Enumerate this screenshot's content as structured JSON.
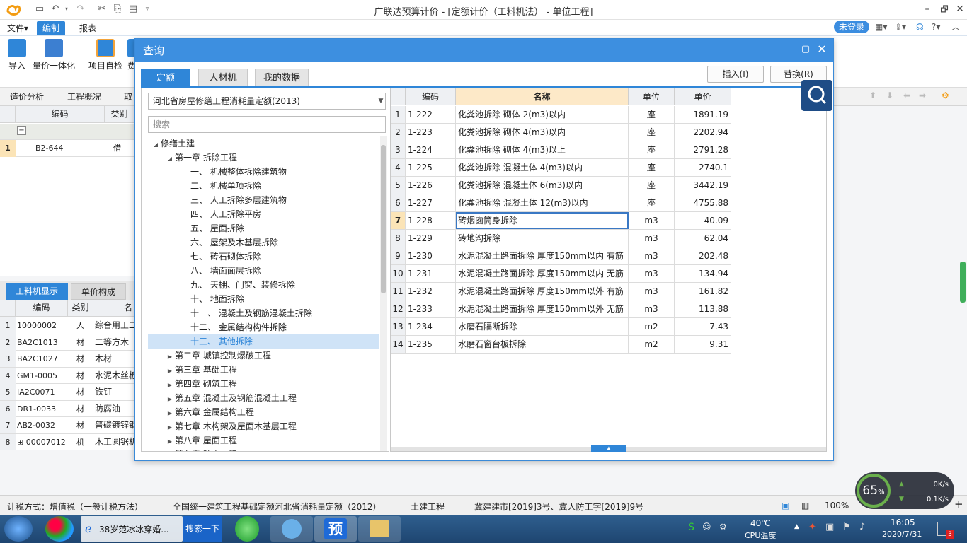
{
  "app": {
    "title": "广联达预算计价 - [定额计价（工料机法） - 单位工程]",
    "window_min": "–",
    "window_restore": "🗗",
    "window_close": "✕"
  },
  "menu": {
    "file": "文件▾",
    "edit": "编制",
    "report": "报表",
    "login": "未登录"
  },
  "ribbon": {
    "import": "导入",
    "price_integration": "量价一体化",
    "self_check": "项目自检",
    "more": "费"
  },
  "left_tabs": [
    "造价分析",
    "工程概况",
    "取"
  ],
  "upper_grid": {
    "headers": [
      "编码",
      "类别"
    ],
    "rows": [
      {
        "num": "",
        "code": "⊟",
        "type": ""
      },
      {
        "num": "1",
        "code": "B2-644",
        "type": "借"
      }
    ]
  },
  "lower_tabs": {
    "active": "工料机显示",
    "second": "单价构成"
  },
  "lower_grid": {
    "headers": [
      "编码",
      "类别",
      "名"
    ],
    "rows": [
      {
        "num": "1",
        "code": "10000002",
        "type": "人",
        "name": "综合用工二"
      },
      {
        "num": "2",
        "code": "BA2C1013",
        "type": "材",
        "name": "二等方木"
      },
      {
        "num": "3",
        "code": "BA2C1027",
        "type": "材",
        "name": "木材"
      },
      {
        "num": "4",
        "code": "GM1-0005",
        "type": "材",
        "name": "水泥木丝板"
      },
      {
        "num": "5",
        "code": "IA2C0071",
        "type": "材",
        "name": "铁钉"
      },
      {
        "num": "6",
        "code": "DR1-0033",
        "type": "材",
        "name": "防腐油"
      },
      {
        "num": "7",
        "code": "AB2-0032",
        "type": "材",
        "name": "普碳镀锌钢"
      },
      {
        "num": "8",
        "code": "⊞ 00007012",
        "type": "机",
        "name": "木工圆锯机"
      }
    ]
  },
  "status": {
    "tax": "计税方式：增值税（一般计税方法）",
    "quota": "全国统一建筑工程基础定额河北省消耗量定额（2012）",
    "discipline": "土建工程",
    "doc": "冀建建市[2019]3号、冀人防工字[2019]9号",
    "zoom": "100%"
  },
  "taskbar": {
    "browser_title": "38岁范冰冰穿婚...",
    "search_btn": "搜索一下",
    "pre": "预",
    "temp": "40℃",
    "temp_label": "CPU温度",
    "time": "16:05",
    "date": "2020/7/31",
    "notif": "3"
  },
  "monitor": {
    "cpu": "65",
    "up": "0K/s",
    "down": "0.1K/s"
  },
  "dialog": {
    "title": "查询",
    "tabs": [
      "定额",
      "人材机",
      "我的数据"
    ],
    "insert_btn": "插入(I)",
    "replace_btn": "替换(R)",
    "quota_select": "河北省房屋修缮工程消耗量定额(2013)",
    "search_placeholder": "搜索",
    "tree": [
      {
        "label": "修缮土建",
        "level": 0,
        "toggle": "◢"
      },
      {
        "label": "第一章  拆除工程",
        "level": 1,
        "toggle": "◢"
      },
      {
        "label": "一、  机械整体拆除建筑物",
        "level": 2,
        "toggle": ""
      },
      {
        "label": "二、  机械单项拆除",
        "level": 2,
        "toggle": ""
      },
      {
        "label": "三、  人工拆除多层建筑物",
        "level": 2,
        "toggle": ""
      },
      {
        "label": "四、  人工拆除平房",
        "level": 2,
        "toggle": ""
      },
      {
        "label": "五、  屋面拆除",
        "level": 2,
        "toggle": ""
      },
      {
        "label": "六、  屋架及木基层拆除",
        "level": 2,
        "toggle": ""
      },
      {
        "label": "七、  砖石砌体拆除",
        "level": 2,
        "toggle": ""
      },
      {
        "label": "八、  墙面面层拆除",
        "level": 2,
        "toggle": ""
      },
      {
        "label": "九、  天棚、门窗、装修拆除",
        "level": 2,
        "toggle": ""
      },
      {
        "label": "十、  地面拆除",
        "level": 2,
        "toggle": ""
      },
      {
        "label": "十一、  混凝土及钢筋混凝土拆除",
        "level": 2,
        "toggle": ""
      },
      {
        "label": "十二、  金属结构构件拆除",
        "level": 2,
        "toggle": ""
      },
      {
        "label": "十三、  其他拆除",
        "level": 2,
        "toggle": ""
      },
      {
        "label": "第二章  城镇控制爆破工程",
        "level": 1,
        "toggle": "▶"
      },
      {
        "label": "第三章  基础工程",
        "level": 1,
        "toggle": "▶"
      },
      {
        "label": "第四章  砌筑工程",
        "level": 1,
        "toggle": "▶"
      },
      {
        "label": "第五章  混凝土及钢筋混凝土工程",
        "level": 1,
        "toggle": "▶"
      },
      {
        "label": "第六章  金属结构工程",
        "level": 1,
        "toggle": "▶"
      },
      {
        "label": "第七章  木构架及屋面木基层工程",
        "level": 1,
        "toggle": "▶"
      },
      {
        "label": "第八章  屋面工程",
        "level": 1,
        "toggle": "▶"
      },
      {
        "label": "第九章  防水工程",
        "level": 1,
        "toggle": "▶"
      }
    ],
    "table": {
      "headers": [
        "编码",
        "名称",
        "单位",
        "单价"
      ],
      "rows": [
        {
          "num": "1",
          "code": "1-222",
          "name": "化粪池拆除 砌体 2(m3)以内",
          "unit": "座",
          "price": "1891.19"
        },
        {
          "num": "2",
          "code": "1-223",
          "name": "化粪池拆除 砌体 4(m3)以内",
          "unit": "座",
          "price": "2202.94"
        },
        {
          "num": "3",
          "code": "1-224",
          "name": "化粪池拆除 砌体 4(m3)以上",
          "unit": "座",
          "price": "2791.28"
        },
        {
          "num": "4",
          "code": "1-225",
          "name": "化粪池拆除 混凝土体 4(m3)以内",
          "unit": "座",
          "price": "2740.1"
        },
        {
          "num": "5",
          "code": "1-226",
          "name": "化粪池拆除 混凝土体 6(m3)以内",
          "unit": "座",
          "price": "3442.19"
        },
        {
          "num": "6",
          "code": "1-227",
          "name": "化粪池拆除 混凝土体 12(m3)以内",
          "unit": "座",
          "price": "4755.88"
        },
        {
          "num": "7",
          "code": "1-228",
          "name": "砖烟囱筒身拆除",
          "unit": "m3",
          "price": "40.09"
        },
        {
          "num": "8",
          "code": "1-229",
          "name": "砖地沟拆除",
          "unit": "m3",
          "price": "62.04"
        },
        {
          "num": "9",
          "code": "1-230",
          "name": "水泥混凝土路面拆除 厚度150mm以内 有筋",
          "unit": "m3",
          "price": "202.48"
        },
        {
          "num": "10",
          "code": "1-231",
          "name": "水泥混凝土路面拆除 厚度150mm以内 无筋",
          "unit": "m3",
          "price": "134.94"
        },
        {
          "num": "11",
          "code": "1-232",
          "name": "水泥混凝土路面拆除 厚度150mm以外 有筋",
          "unit": "m3",
          "price": "161.82"
        },
        {
          "num": "12",
          "code": "1-233",
          "name": "水泥混凝土路面拆除 厚度150mm以外 无筋",
          "unit": "m3",
          "price": "113.88"
        },
        {
          "num": "13",
          "code": "1-234",
          "name": "水磨石隔断拆除",
          "unit": "m2",
          "price": "7.43"
        },
        {
          "num": "14",
          "code": "1-235",
          "name": "水磨石窗台板拆除",
          "unit": "m2",
          "price": "9.31"
        }
      ]
    }
  }
}
